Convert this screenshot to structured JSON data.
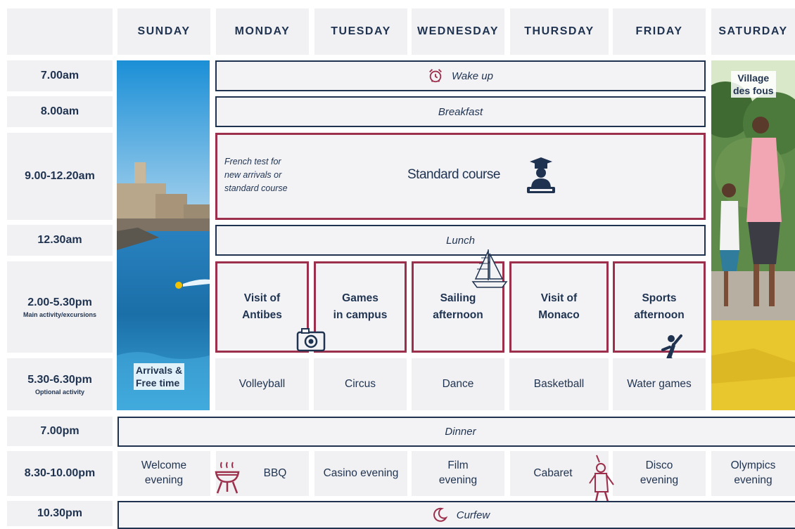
{
  "header": {
    "days": [
      "SUNDAY",
      "MONDAY",
      "TUESDAY",
      "WEDNESDAY",
      "THURSDAY",
      "FRIDAY",
      "SATURDAY"
    ]
  },
  "times": [
    {
      "label": "7.00am",
      "sub": ""
    },
    {
      "label": "8.00am",
      "sub": ""
    },
    {
      "label": "9.00-12.20am",
      "sub": ""
    },
    {
      "label": "12.30am",
      "sub": ""
    },
    {
      "label": "2.00-5.30pm",
      "sub": "Main activity/excursions"
    },
    {
      "label": "5.30-6.30pm",
      "sub": "Optional activity"
    },
    {
      "label": "7.00pm",
      "sub": ""
    },
    {
      "label": "8.30-10.00pm",
      "sub": ""
    },
    {
      "label": "10.30pm",
      "sub": ""
    }
  ],
  "sunday": {
    "arrivals": "Arrivals &\nFree time"
  },
  "saturday": {
    "village": "Village\ndes fous"
  },
  "morning": {
    "wake_up": "Wake up",
    "breakfast": "Breakfast",
    "french_test": "French test for\nnew arrivals or\nstandard course",
    "standard_course": "Standard course",
    "lunch": "Lunch"
  },
  "afternoon": [
    "Visit of\nAntibes",
    "Games\nin campus",
    "Sailing\nafternoon",
    "Visit of\nMonaco",
    "Sports\nafternoon"
  ],
  "optional": [
    "Volleyball",
    "Circus",
    "Dance",
    "Basketball",
    "Water games"
  ],
  "dinner": "Dinner",
  "evening": [
    "Welcome\nevening",
    "BBQ",
    "Casino evening",
    "Film\nevening",
    "Cabaret",
    "Disco\nevening",
    "Olympics\nevening"
  ],
  "curfew": "Curfew",
  "colors": {
    "navy": "#1f3350",
    "burgundy": "#9c2f4b",
    "cell": "#f1f1f3"
  },
  "icons": [
    "alarm-clock-icon",
    "graduation-cap-icon",
    "sailboat-icon",
    "camera-icon",
    "climber-icon",
    "bbq-grill-icon",
    "dancer-icon",
    "moon-icon"
  ]
}
